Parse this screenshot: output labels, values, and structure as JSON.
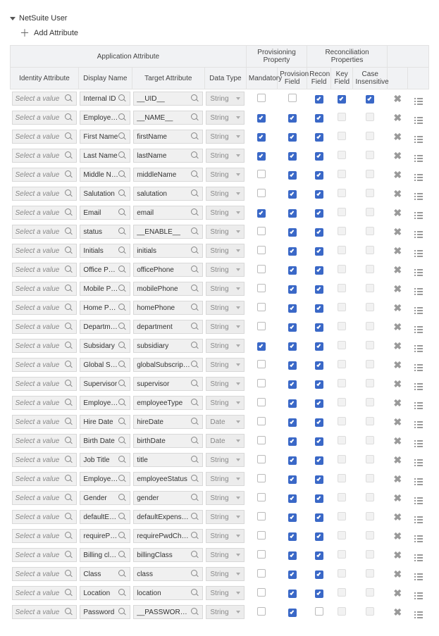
{
  "section": {
    "title": "NetSuite User"
  },
  "actions": {
    "add": "Add Attribute"
  },
  "headerGroups": {
    "app": "Application Attribute",
    "prov": "Provisioning Property",
    "recon": "Reconciliation Properties"
  },
  "columns": {
    "identity": "Identity Attribute",
    "display": "Display Name",
    "target": "Target Attribute",
    "dtype": "Data Type",
    "mandatory": "Mandatory",
    "provField": "Provision Field",
    "reconField": "Recon Field",
    "keyField": "Key Field",
    "caseIns": "Case Insensitive"
  },
  "placeholders": {
    "identity": "Select a value"
  },
  "rows": [
    {
      "display": "Internal ID",
      "target": "__UID__",
      "dtype": "String",
      "mandatory": false,
      "prov": false,
      "recon": true,
      "key": true,
      "caseIns": true
    },
    {
      "display": "Employee Id",
      "target": "__NAME__",
      "dtype": "String",
      "mandatory": true,
      "prov": true,
      "recon": true,
      "key": false,
      "caseIns": false
    },
    {
      "display": "First Name",
      "target": "firstName",
      "dtype": "String",
      "mandatory": true,
      "prov": true,
      "recon": true,
      "key": false,
      "caseIns": false
    },
    {
      "display": "Last Name",
      "target": "lastName",
      "dtype": "String",
      "mandatory": true,
      "prov": true,
      "recon": true,
      "key": false,
      "caseIns": false
    },
    {
      "display": "Middle Name",
      "target": "middleName",
      "dtype": "String",
      "mandatory": false,
      "prov": true,
      "recon": true,
      "key": false,
      "caseIns": false
    },
    {
      "display": "Salutation",
      "target": "salutation",
      "dtype": "String",
      "mandatory": false,
      "prov": true,
      "recon": true,
      "key": false,
      "caseIns": false
    },
    {
      "display": "Email",
      "target": "email",
      "dtype": "String",
      "mandatory": true,
      "prov": true,
      "recon": true,
      "key": false,
      "caseIns": false
    },
    {
      "display": "status",
      "target": "__ENABLE__",
      "dtype": "String",
      "mandatory": false,
      "prov": true,
      "recon": true,
      "key": false,
      "caseIns": false
    },
    {
      "display": "Initials",
      "target": "initials",
      "dtype": "String",
      "mandatory": false,
      "prov": true,
      "recon": true,
      "key": false,
      "caseIns": false
    },
    {
      "display": "Office Phone",
      "target": "officePhone",
      "dtype": "String",
      "mandatory": false,
      "prov": true,
      "recon": true,
      "key": false,
      "caseIns": false
    },
    {
      "display": "Mobile Phone",
      "target": "mobilePhone",
      "dtype": "String",
      "mandatory": false,
      "prov": true,
      "recon": true,
      "key": false,
      "caseIns": false
    },
    {
      "display": "Home Phone",
      "target": "homePhone",
      "dtype": "String",
      "mandatory": false,
      "prov": true,
      "recon": true,
      "key": false,
      "caseIns": false
    },
    {
      "display": "Department",
      "target": "department",
      "dtype": "String",
      "mandatory": false,
      "prov": true,
      "recon": true,
      "key": false,
      "caseIns": false
    },
    {
      "display": "Subsidary",
      "target": "subsidiary",
      "dtype": "String",
      "mandatory": true,
      "prov": true,
      "recon": true,
      "key": false,
      "caseIns": false
    },
    {
      "display": "Global Subscripti",
      "target": "globalSubscriptionStatus",
      "dtype": "String",
      "mandatory": false,
      "prov": true,
      "recon": true,
      "key": false,
      "caseIns": false
    },
    {
      "display": "Supervisor",
      "target": "supervisor",
      "dtype": "String",
      "mandatory": false,
      "prov": true,
      "recon": true,
      "key": false,
      "caseIns": false
    },
    {
      "display": "Employee Type",
      "target": "employeeType",
      "dtype": "String",
      "mandatory": false,
      "prov": true,
      "recon": true,
      "key": false,
      "caseIns": false
    },
    {
      "display": "Hire Date",
      "target": "hireDate",
      "dtype": "Date",
      "mandatory": false,
      "prov": true,
      "recon": true,
      "key": false,
      "caseIns": false
    },
    {
      "display": "Birth Date",
      "target": "birthDate",
      "dtype": "Date",
      "mandatory": false,
      "prov": true,
      "recon": true,
      "key": false,
      "caseIns": false
    },
    {
      "display": "Job Title",
      "target": "title",
      "dtype": "String",
      "mandatory": false,
      "prov": true,
      "recon": true,
      "key": false,
      "caseIns": false
    },
    {
      "display": "Employee Status",
      "target": "employeeStatus",
      "dtype": "String",
      "mandatory": false,
      "prov": true,
      "recon": true,
      "key": false,
      "caseIns": false
    },
    {
      "display": "Gender",
      "target": "gender",
      "dtype": "String",
      "mandatory": false,
      "prov": true,
      "recon": true,
      "key": false,
      "caseIns": false
    },
    {
      "display": "defaultExpenseR",
      "target": "defaultExpenseReportC...",
      "dtype": "String",
      "mandatory": false,
      "prov": true,
      "recon": true,
      "key": false,
      "caseIns": false
    },
    {
      "display": "requirePwdChan",
      "target": "requirePwdChange",
      "dtype": "String",
      "mandatory": false,
      "prov": true,
      "recon": true,
      "key": false,
      "caseIns": false
    },
    {
      "display": "Billing class",
      "target": "billingClass",
      "dtype": "String",
      "mandatory": false,
      "prov": true,
      "recon": true,
      "key": false,
      "caseIns": false
    },
    {
      "display": "Class",
      "target": "class",
      "dtype": "String",
      "mandatory": false,
      "prov": true,
      "recon": true,
      "key": false,
      "caseIns": false
    },
    {
      "display": "Location",
      "target": "location",
      "dtype": "String",
      "mandatory": false,
      "prov": true,
      "recon": true,
      "key": false,
      "caseIns": false
    },
    {
      "display": "Password",
      "target": "__PASSWORD__",
      "dtype": "String",
      "mandatory": false,
      "prov": true,
      "recon": false,
      "key": false,
      "caseIns": false
    }
  ]
}
